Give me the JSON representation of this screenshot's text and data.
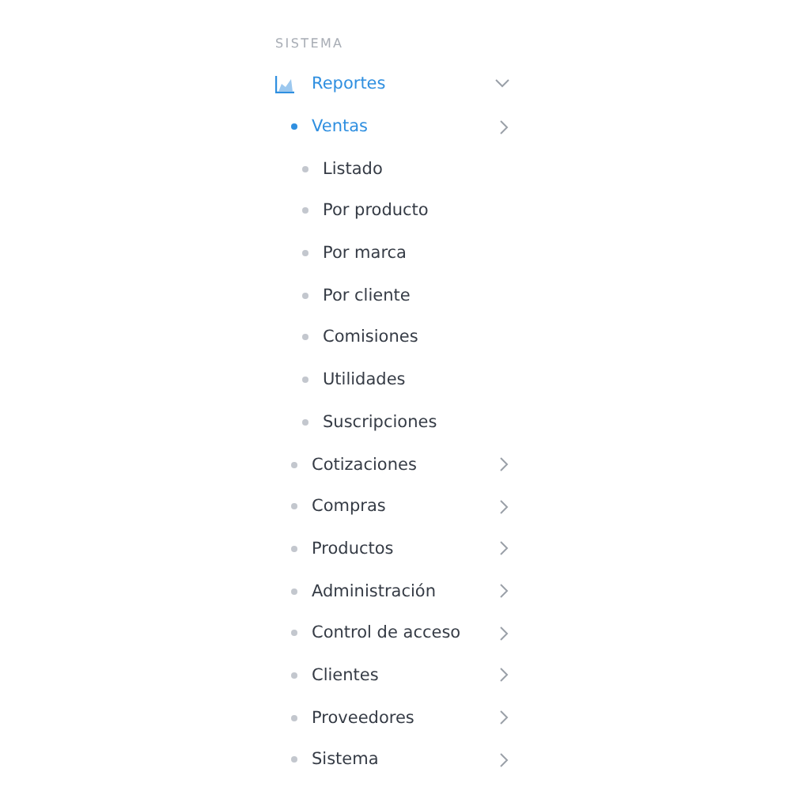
{
  "section_label": "SISTEMA",
  "menu": [
    {
      "label": "Reportes",
      "kind": "icon",
      "selected": true,
      "expanded": true,
      "children": [
        {
          "label": "Ventas",
          "selected": true,
          "expanded": false,
          "children": [
            {
              "label": "Listado",
              "selected": false
            },
            {
              "label": "Por producto",
              "selected": false
            },
            {
              "label": "Por marca",
              "selected": false
            },
            {
              "label": "Por cliente",
              "selected": false
            },
            {
              "label": "Comisiones",
              "selected": false
            },
            {
              "label": "Utilidades",
              "selected": false
            },
            {
              "label": "Suscripciones",
              "selected": false
            }
          ]
        },
        {
          "label": "Cotizaciones",
          "selected": false,
          "expanded": false
        },
        {
          "label": "Compras",
          "selected": false,
          "expanded": false
        },
        {
          "label": "Productos",
          "selected": false,
          "expanded": false
        },
        {
          "label": "Administración",
          "selected": false,
          "expanded": false
        },
        {
          "label": "Control de acceso",
          "selected": false,
          "expanded": false
        },
        {
          "label": "Clientes",
          "selected": false,
          "expanded": false
        },
        {
          "label": "Proveedores",
          "selected": false,
          "expanded": false
        },
        {
          "label": "Sistema",
          "selected": false,
          "expanded": false
        }
      ]
    }
  ]
}
